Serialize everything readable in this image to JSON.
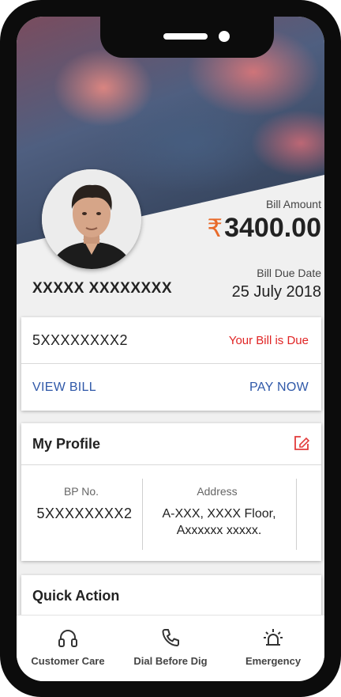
{
  "bill": {
    "amount_label": "Bill Amount",
    "currency_symbol": "₹",
    "amount": "3400.00",
    "due_label": "Bill Due Date",
    "due_date": "25 July 2018"
  },
  "customer": {
    "name": "XXXXX XXXXXXXX"
  },
  "account": {
    "number": "5XXXXXXXX2",
    "status": "Your Bill is Due",
    "view_bill_label": "VIEW BILL",
    "pay_now_label": "PAY NOW"
  },
  "profile": {
    "title": "My Profile",
    "bp_label": "BP No.",
    "bp_value": "5XXXXXXXX2",
    "address_label": "Address",
    "address_line1": "A-XXX, XXXX Floor,",
    "address_line2": "Axxxxxx xxxxx."
  },
  "quick_action": {
    "title": "Quick Action"
  },
  "bottom_nav": {
    "items": [
      {
        "label": "Customer Care",
        "icon": "headphones-icon"
      },
      {
        "label": "Dial Before Dig",
        "icon": "phone-icon"
      },
      {
        "label": "Emergency",
        "icon": "alarm-light-icon"
      }
    ]
  },
  "colors": {
    "accent_blue": "#2f58a8",
    "due_red": "#e02424",
    "rupee_orange": "#e86a2a"
  }
}
